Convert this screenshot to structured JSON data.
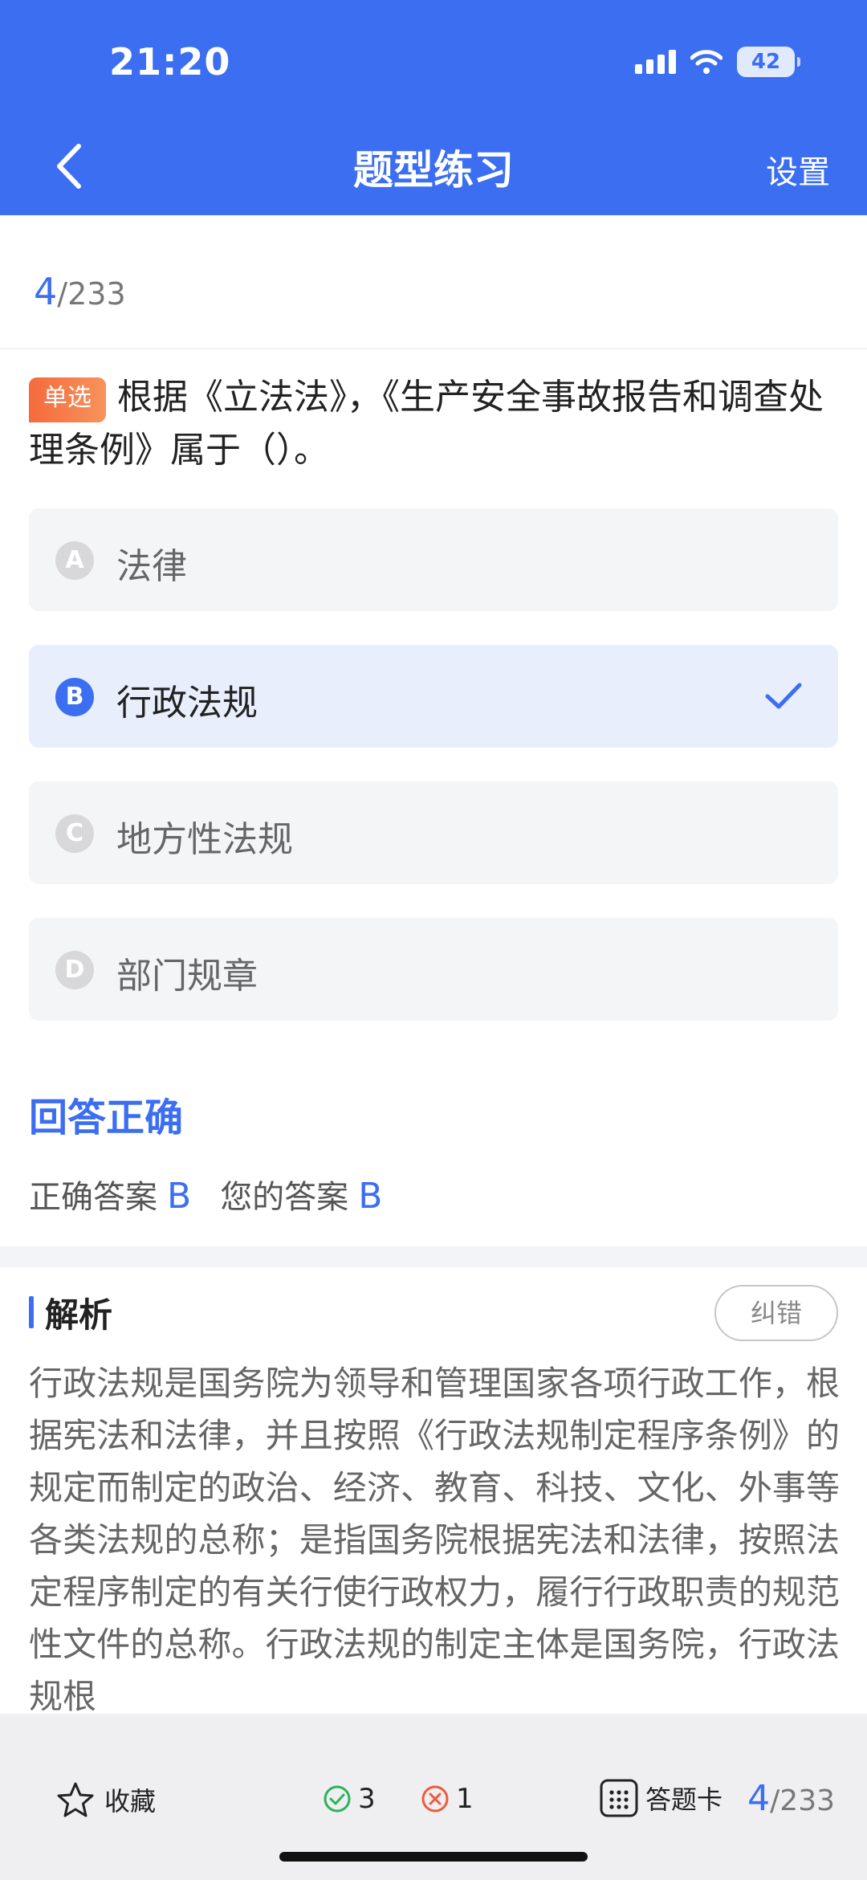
{
  "status_bar": {
    "time": "21:20",
    "battery": "42"
  },
  "nav": {
    "title": "题型练习",
    "settings_label": "设置"
  },
  "progress": {
    "current": "4",
    "total": "/233"
  },
  "question": {
    "type_badge": "单选",
    "text": "根据《立法法》，《生产安全事故报告和调查处理条例》属于（）。"
  },
  "options": [
    {
      "letter": "A",
      "text": "法律",
      "selected": false
    },
    {
      "letter": "B",
      "text": "行政法规",
      "selected": true
    },
    {
      "letter": "C",
      "text": "地方性法规",
      "selected": false
    },
    {
      "letter": "D",
      "text": "部门规章",
      "selected": false
    }
  ],
  "result": {
    "title": "回答正确",
    "correct_label": "正确答案",
    "correct_value": "B",
    "your_label": "您的答案",
    "your_value": "B"
  },
  "analysis": {
    "title": "解析",
    "report_label": "纠错",
    "text": "行政法规是国务院为领导和管理国家各项行政工作，根据宪法和法律，并且按照《行政法规制定程序条例》的规定而制定的政治、经济、教育、科技、文化、外事等各类法规的总称；是指国务院根据宪法和法律，按照法定程序制定的有关行使行政权力，履行行政职责的规范性文件的总称。行政法规的制定主体是国务院，行政法规根"
  },
  "bottom_bar": {
    "favorite_label": "收藏",
    "correct_count": "3",
    "wrong_count": "1",
    "answer_card_label": "答题卡",
    "current": "4",
    "total": "/233"
  },
  "colors": {
    "accent": "#3b6ef0",
    "badge": "#f56a3c",
    "correct": "#2bb35a",
    "wrong": "#f05a3c"
  }
}
